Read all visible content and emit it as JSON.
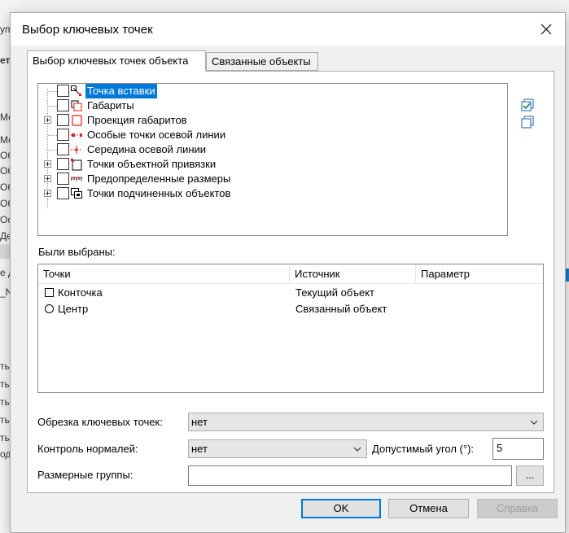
{
  "background": {
    "left_items": [
      "уп",
      "етр",
      "Мет",
      "Мод",
      "Обо",
      "Объ",
      "Объ",
      "Объ",
      "Ось",
      "Дер",
      "е д",
      "_NA",
      "тые",
      "тые",
      "тые",
      "тые",
      "тые",
      "одн"
    ]
  },
  "dialog": {
    "title": "Выбор ключевых точек",
    "tabs": [
      {
        "label": "Выбор ключевых точек объекта",
        "active": true
      },
      {
        "label": "Связанные объекты",
        "active": false
      }
    ],
    "tree": [
      {
        "label": "Точка вставки",
        "icon": "insert-point-icon",
        "expandable": false,
        "selected": true
      },
      {
        "label": "Габариты",
        "icon": "bounds-icon",
        "expandable": false,
        "selected": false
      },
      {
        "label": "Проекция габаритов",
        "icon": "bounds-projection-icon",
        "expandable": true,
        "selected": false
      },
      {
        "label": "Особые точки осевой линии",
        "icon": "axis-special-points-icon",
        "expandable": false,
        "selected": false
      },
      {
        "label": "Середина осевой линии",
        "icon": "axis-midpoint-icon",
        "expandable": false,
        "selected": false
      },
      {
        "label": "Точки объектной привязки",
        "icon": "object-snap-icon",
        "expandable": true,
        "selected": false
      },
      {
        "label": "Предопределенные размеры",
        "icon": "predefined-dimensions-icon",
        "expandable": true,
        "selected": false
      },
      {
        "label": "Точки подчиненных объектов",
        "icon": "subordinate-objects-icon",
        "expandable": true,
        "selected": false
      }
    ],
    "selected_section": {
      "label": "Были выбраны:",
      "columns": [
        "Точки",
        "Источник",
        "Параметр"
      ],
      "rows": [
        {
          "shape": "square",
          "point": "Конточка",
          "source": "Текущий объект",
          "param": ""
        },
        {
          "shape": "circle",
          "point": "Центр",
          "source": "Связанный объект",
          "param": ""
        }
      ]
    },
    "form": {
      "trim_label": "Обрезка ключевых точек:",
      "trim_value": "нет",
      "normals_label": "Контроль нормалей:",
      "normals_value": "нет",
      "angle_label": "Допустимый угол (°):",
      "angle_value": "5",
      "dim_groups_label": "Размерные группы:",
      "dim_groups_value": "",
      "browse_label": "..."
    },
    "buttons": {
      "ok": "OK",
      "cancel": "Отмена",
      "help": "Справка"
    }
  },
  "colors": {
    "accent": "#0078d7",
    "icon_red": "#e0201b",
    "icon_green": "#2e8b57",
    "icon_blue": "#1a5fb4"
  }
}
